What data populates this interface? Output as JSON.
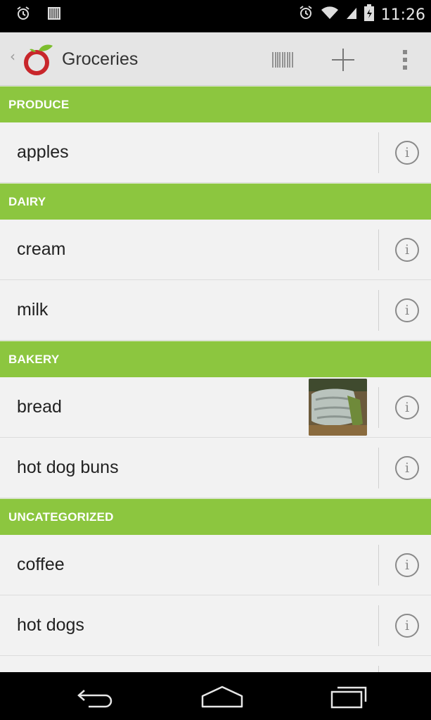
{
  "status_bar": {
    "left_icons": [
      "alarm-icon",
      "barcode-notification-icon"
    ],
    "right_icons": [
      "alarm-icon",
      "wifi-icon",
      "signal-icon",
      "battery-icon"
    ],
    "time": "11:26"
  },
  "action_bar": {
    "title": "Groceries",
    "icons": [
      "back-chevron-icon",
      "app-logo-icon",
      "barcode-icon",
      "plus-icon",
      "overflow-menu-icon"
    ]
  },
  "sections": [
    {
      "header": "PRODUCE",
      "items": [
        {
          "label": "apples"
        }
      ]
    },
    {
      "header": "DAIRY",
      "items": [
        {
          "label": "cream"
        },
        {
          "label": "milk"
        }
      ]
    },
    {
      "header": "BAKERY",
      "items": [
        {
          "label": "bread",
          "has_photo": true
        },
        {
          "label": "hot dog buns"
        }
      ]
    },
    {
      "header": "UNCATEGORIZED",
      "items": [
        {
          "label": "coffee"
        },
        {
          "label": "hot dogs"
        },
        {
          "label": ""
        }
      ]
    }
  ],
  "item_action_icon": "info-icon",
  "nav_bar": {
    "icons": [
      "back-icon",
      "home-icon",
      "recents-icon"
    ]
  },
  "colors": {
    "section_header": "#8cc63f",
    "status_bar": "#000000",
    "action_bar": "#e5e5e5",
    "list_bg": "#f2f2f2"
  }
}
